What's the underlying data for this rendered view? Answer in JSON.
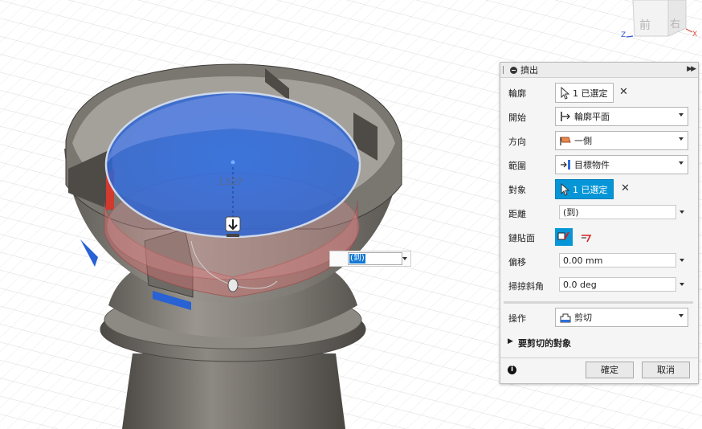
{
  "viewcube": {
    "face_front": "前",
    "face_right": "右",
    "axis_x": "X",
    "axis_z": "Z"
  },
  "viewport": {
    "dimension_label": "1.527"
  },
  "inline_input": {
    "value": "(到)"
  },
  "panel": {
    "title": "擠出",
    "rows": {
      "profile": {
        "label": "輪廓",
        "value": "1 已選定"
      },
      "start": {
        "label": "開始",
        "value": "輪廓平面"
      },
      "direction": {
        "label": "方向",
        "value": "一側"
      },
      "extent": {
        "label": "範圍",
        "value": "目標物件"
      },
      "object": {
        "label": "對象",
        "value": "1 已選定"
      },
      "distance": {
        "label": "距離",
        "value": "(到)"
      },
      "chain_face": {
        "label": "鏈貼面"
      },
      "offset": {
        "label": "偏移",
        "value": "0.00 mm"
      },
      "taper": {
        "label": "掃掠斜角",
        "value": "0.0 deg"
      },
      "operation": {
        "label": "操作",
        "value": "剪切"
      }
    },
    "section": {
      "label": "要剪切的對象"
    },
    "ok_label": "確定",
    "cancel_label": "取消"
  },
  "colors": {
    "accent": "#0696d7",
    "selection_blue": "#1f6fe0",
    "body_gray": "#8a8680"
  }
}
